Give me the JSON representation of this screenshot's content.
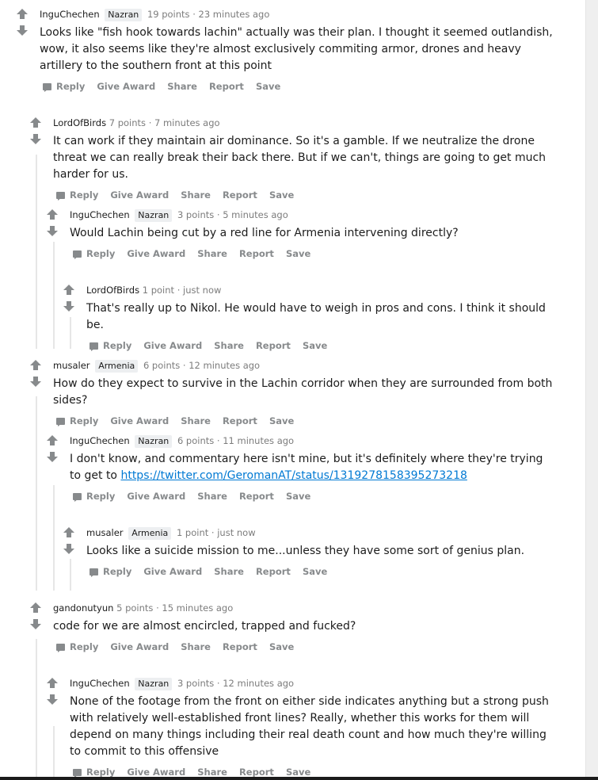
{
  "actions": {
    "reply": "Reply",
    "give_award": "Give Award",
    "share": "Share",
    "report": "Report",
    "save": "Save"
  },
  "comments": [
    {
      "author": "InguChechen",
      "flair": "Nazran",
      "points": "19 points",
      "sep": "·",
      "time": "23 minutes ago",
      "body": "Looks like \"fish hook towards lachin\" actually was their plan. I thought it seemed outlandish, wow, it also seems like they're almost exclusively commiting armor, drones and heavy artillery to the southern front at this point"
    },
    {
      "author": "LordOfBirds",
      "points": "7 points",
      "sep": "·",
      "time": "7 minutes ago",
      "body": "It can work if they maintain air dominance. So it's a gamble. If we neutralize the drone threat we can really break their back there. But if we can't, things are going to get much harder for us."
    },
    {
      "author": "InguChechen",
      "flair": "Nazran",
      "points": "3 points",
      "sep": "·",
      "time": "5 minutes ago",
      "body": "Would Lachin being cut by a red line for Armenia intervening directly?"
    },
    {
      "author": "LordOfBirds",
      "points": "1 point",
      "sep": "·",
      "time": "just now",
      "body": "That's really up to Nikol. He would have to weigh in pros and cons. I think it should be."
    },
    {
      "author": "musaler",
      "flair": "Armenia",
      "points": "6 points",
      "sep": "·",
      "time": "12 minutes ago",
      "body": "How do they expect to survive in the Lachin corridor when they are surrounded from both sides?"
    },
    {
      "author": "InguChechen",
      "flair": "Nazran",
      "points": "6 points",
      "sep": "·",
      "time": "11 minutes ago",
      "body": "I don't know, and commentary here isn't mine, but it's definitely where they're trying to get to",
      "link": "https://twitter.com/GeromanAT/status/1319278158395273218"
    },
    {
      "author": "musaler",
      "flair": "Armenia",
      "points": "1 point",
      "sep": "·",
      "time": "just now",
      "body": "Looks like a suicide mission to me...unless they have some sort of genius plan."
    },
    {
      "author": "gandonutyun",
      "points": "5 points",
      "sep": "·",
      "time": "15 minutes ago",
      "body": "code for we are almost encircled, trapped and fucked?"
    },
    {
      "author": "InguChechen",
      "flair": "Nazran",
      "points": "3 points",
      "sep": "·",
      "time": "12 minutes ago",
      "body": "None of the footage from the front on either side indicates anything but a strong push with relatively well-established front lines? Really, whether this works for them will depend on many things including their real death count and how much they're willing to commit to this offensive"
    }
  ]
}
